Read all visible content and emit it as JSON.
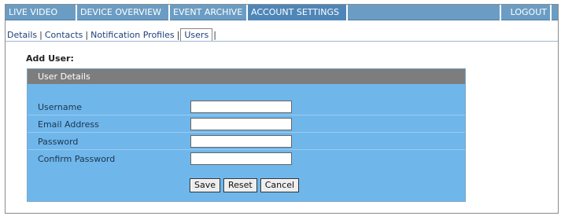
{
  "topnav": {
    "items": [
      {
        "label": "LIVE VIDEO",
        "active": false
      },
      {
        "label": "DEVICE OVERVIEW",
        "active": false
      },
      {
        "label": "EVENT ARCHIVE",
        "active": false
      },
      {
        "label": "ACCOUNT SETTINGS",
        "active": true
      }
    ],
    "logout_label": "LOGOUT"
  },
  "subtabs": {
    "items": [
      {
        "label": "Details",
        "active": false
      },
      {
        "label": "Contacts",
        "active": false
      },
      {
        "label": "Notification Profiles",
        "active": false
      },
      {
        "label": "Users",
        "active": true
      }
    ]
  },
  "page": {
    "title": "Add User:"
  },
  "panel": {
    "header": "User Details",
    "fields": [
      {
        "label": "Username",
        "value": ""
      },
      {
        "label": "Email Address",
        "value": ""
      },
      {
        "label": "Password",
        "value": ""
      },
      {
        "label": "Confirm Password",
        "value": ""
      }
    ],
    "buttons": {
      "save": "Save",
      "reset": "Reset",
      "cancel": "Cancel"
    }
  },
  "colors": {
    "nav_bar": "#6b9dc4",
    "nav_active": "#4f86b8",
    "panel_bg": "#6fb6ea",
    "panel_header": "#7d7d7d"
  }
}
